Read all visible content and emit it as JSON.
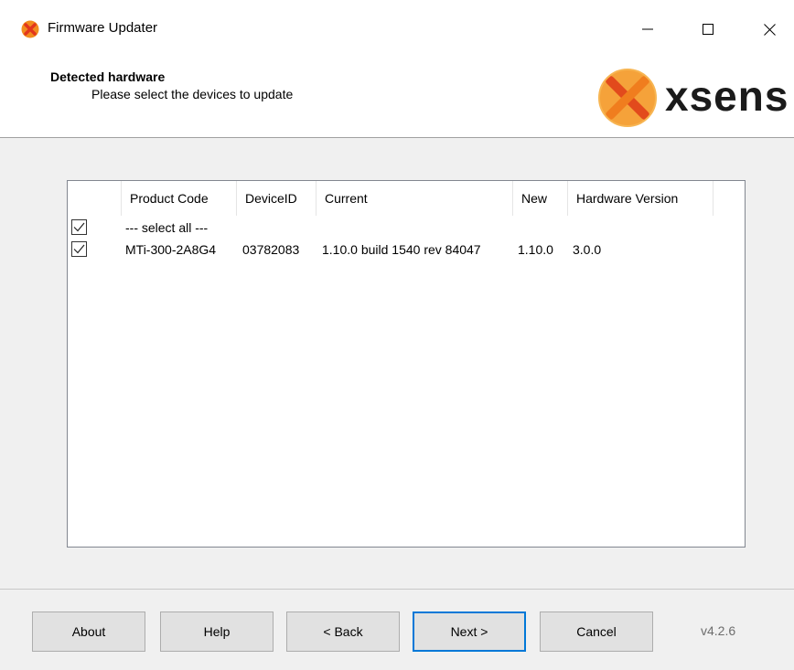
{
  "window": {
    "title": "Firmware Updater"
  },
  "header": {
    "title": "Detected hardware",
    "subtitle": "Please select the devices to update",
    "logo_text": "xsens"
  },
  "table": {
    "columns": [
      "Product Code",
      "DeviceID",
      "Current",
      "New",
      "Hardware Version"
    ],
    "select_all_label": "--- select all ---",
    "select_all_checked": true,
    "rows": [
      {
        "checked": true,
        "product_code": "MTi-300-2A8G4",
        "device_id": "03782083",
        "current": "1.10.0 build 1540 rev 84047",
        "new": "1.10.0",
        "hardware_version": "3.0.0"
      }
    ]
  },
  "footer": {
    "about": "About",
    "help": "Help",
    "back": "< Back",
    "next": "Next >",
    "cancel": "Cancel",
    "version": "v4.2.6"
  },
  "colors": {
    "accent": "#0078d7",
    "logo_orange": "#f39c22"
  }
}
